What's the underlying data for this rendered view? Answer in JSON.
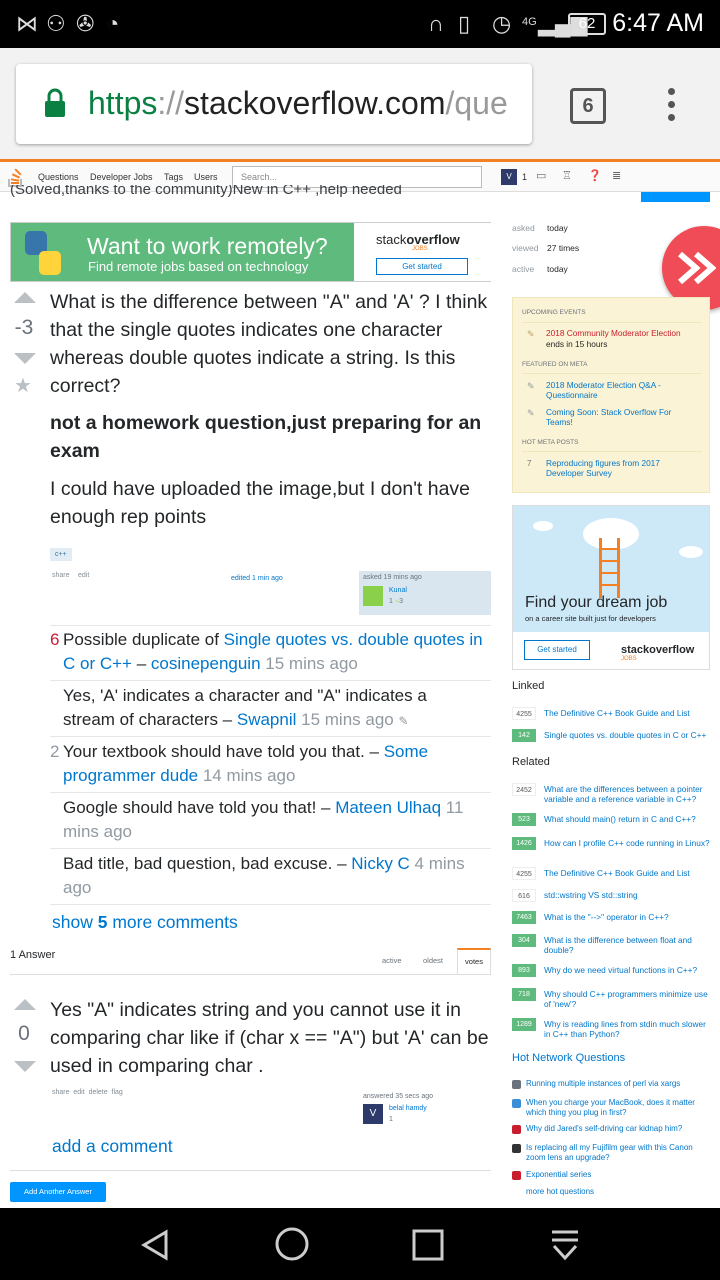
{
  "status": {
    "time": "6:47 AM",
    "battery": "62",
    "net": "4G"
  },
  "browser": {
    "url_scheme": "https",
    "url_sep": "://",
    "url_domain": "stackoverflow.com",
    "url_path": "/que",
    "tab_count": "6"
  },
  "sonav": {
    "questions": "Questions",
    "jobs": "Developer Jobs",
    "tags": "Tags",
    "users": "Users",
    "search_placeholder": "Search...",
    "rep": "1"
  },
  "question_title_partial": "(Solved,thanks to the community)New in C++ ,help needed",
  "ad1": {
    "line1": "Want to work remotely?",
    "line2": "Find remote jobs based on technology",
    "brand1": "stack",
    "brand2": "overflow",
    "brand_sub": "JOBS",
    "cta": "Get started"
  },
  "question": {
    "score": "-3",
    "para1": "What is the difference between \"A\" and 'A' ? I think that the single quotes indicates one character whereas double quotes indicate a string. Is this correct?",
    "para2": "not a homework question,just preparing for an exam",
    "para3": "I could have uploaded the image,but I don't have enough rep points",
    "tag": "c++",
    "share": "share",
    "edit": "edit",
    "edited": "edited 1 min ago",
    "asked": "asked 19 mins ago",
    "user": "Kunal",
    "rep": "1",
    "bronze": "3"
  },
  "comments": [
    {
      "score": "6",
      "pre": "Possible duplicate of ",
      "link": "Single quotes vs. double quotes in C or C++",
      "dash": " – ",
      "user": "cosinepenguin",
      "time": " 15 mins ago"
    },
    {
      "score": "",
      "pre": "Yes, 'A' indicates a character and \"A\" indicates a stream of characters",
      "dash": " – ",
      "user": "Swapnil",
      "time": " 15 mins ago"
    },
    {
      "score": "2",
      "pre": "Your textbook should have told you that.",
      "dash": " – ",
      "user": "Some programmer dude",
      "time": " 14 mins ago"
    },
    {
      "score": "",
      "pre": "Google should have told you that!",
      "dash": " – ",
      "user": "Mateen Ulhaq",
      "time": " 11 mins ago"
    },
    {
      "score": "",
      "pre": "Bad title, bad question, bad excuse.",
      "dash": " – ",
      "user": "Nicky C",
      "time": " 4 mins ago"
    }
  ],
  "show_more": {
    "pre": "show ",
    "num": "5",
    "post": " more comments"
  },
  "answers_header": {
    "count": "1 Answer",
    "active": "active",
    "oldest": "oldest",
    "votes": "votes"
  },
  "answer": {
    "score": "0",
    "text": "Yes \"A\" indicates string and you cannot use it in comparing char like if (char x == \"A\") but 'A' can be used in comparing char .",
    "actions": "share  edit  delete  flag",
    "answered": "answered 35 secs ago",
    "user": "belal hamdy",
    "rep": "1",
    "add_comment": "add a comment",
    "add_answer": "Add Another Answer"
  },
  "sidebar": {
    "asked_label": "asked",
    "asked_val": "today",
    "viewed_label": "viewed",
    "viewed_val": "27 times",
    "active_label": "active",
    "active_val": "today",
    "upcoming": "UPCOMING EVENTS",
    "event1": "2018 Community Moderator Election",
    "event1_sub": "ends in 15 hours",
    "featured": "FEATURED ON META",
    "meta1": "2018 Moderator Election Q&A - Questionnaire",
    "meta2": "Coming Soon: Stack Overflow For Teams!",
    "hotmeta": "HOT META POSTS",
    "hm_num": "7",
    "hm1": "Reproducing figures from 2017 Developer Survey",
    "ad2_line1": "Find your dream job",
    "ad2_line2": "on a career site built just for developers",
    "ad2_cta": "Get started",
    "ad2_brand": "stackoverflow",
    "ad2_sub": "JOBS",
    "linked": "Linked",
    "linked_items": [
      {
        "n": "4255",
        "t": "The Definitive C++ Book Guide and List",
        "g": false
      },
      {
        "n": "142",
        "t": "Single quotes vs. double quotes in C or C++",
        "g": true
      }
    ],
    "related": "Related",
    "related_items": [
      {
        "n": "2452",
        "t": "What are the differences between a pointer variable and a reference variable in C++?",
        "g": false
      },
      {
        "n": "523",
        "t": "What should main() return in C and C++?",
        "g": true
      },
      {
        "n": "1426",
        "t": "How can I profile C++ code running in Linux?",
        "g": true
      },
      {
        "n": "4255",
        "t": "The Definitive C++ Book Guide and List",
        "g": false
      },
      {
        "n": "616",
        "t": "std::wstring VS std::string",
        "g": false
      },
      {
        "n": "7463",
        "t": "What is the \"-->\" operator in C++?",
        "g": true
      },
      {
        "n": "304",
        "t": "What is the difference between float and double?",
        "g": true
      },
      {
        "n": "893",
        "t": "Why do we need virtual functions in C++?",
        "g": true
      },
      {
        "n": "718",
        "t": "Why should C++ programmers minimize use of 'new'?",
        "g": true
      },
      {
        "n": "1289",
        "t": "Why is reading lines from stdin much slower in C++ than Python?",
        "g": true
      }
    ],
    "hnq": "Hot Network Questions",
    "hnq_items": [
      "Running multiple instances of perl via xargs",
      "When you charge your MacBook, does it matter which thing you plug in first?",
      "Why did Jared's self-driving car kidnap him?",
      "Is replacing all my Fujifilm gear with this Canon zoom lens an upgrade?",
      "Exponential series"
    ],
    "more_hot": "more hot questions"
  },
  "colors": {
    "link": "#0077cc",
    "accent": "#f48024",
    "green": "#5eba7d",
    "meta_bg": "#fbf3d5"
  }
}
